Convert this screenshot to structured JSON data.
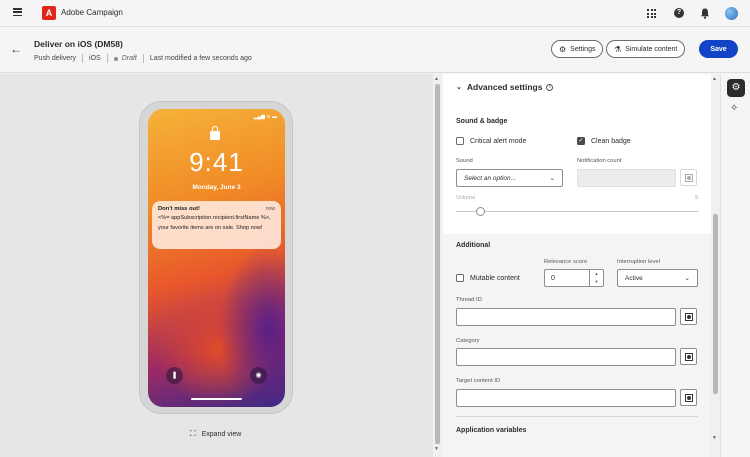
{
  "app": {
    "title": "Adobe Campaign",
    "logo_letter": "A"
  },
  "header": {
    "title": "Deliver on iOS (DM58)",
    "channel": "Push delivery",
    "platform": "iOS",
    "status": "Draft",
    "modified": "Last modified a few seconds ago",
    "settings_label": "Settings",
    "simulate_label": "Simulate content",
    "save_label": "Save"
  },
  "preview": {
    "status_icons": "▂▄▆ ≋ ▬",
    "time": "9:41",
    "date": "Monday, June 3",
    "notification": {
      "title": "Don't miss out!",
      "time": "now",
      "body": "<%= appSubscription.recipient.firstName %>, your favorite items are on sale. Shop now!"
    },
    "expand_label": "Expand view"
  },
  "panel": {
    "section_title": "Advanced settings",
    "sound_badge": {
      "heading": "Sound & badge",
      "critical_alert": {
        "label": "Critical alert mode",
        "checked": false
      },
      "clean_badge": {
        "label": "Clean badge",
        "checked": true
      },
      "sound_label": "Sound",
      "sound_placeholder": "Select an option...",
      "notification_count_label": "Notification count",
      "volume_label": "Volume",
      "volume_max": "9",
      "volume_value": 1
    },
    "additional": {
      "heading": "Additional",
      "mutable_content": {
        "label": "Mutable content",
        "checked": false
      },
      "relevance_label": "Relevance score",
      "relevance_value": "0",
      "interruption_label": "Interruption level",
      "interruption_value": "Active",
      "thread_id_label": "Thread ID",
      "category_label": "Category",
      "target_content_label": "Target content ID"
    },
    "app_variables_heading": "Application variables"
  },
  "colors": {
    "primary": "#1344c8",
    "adobe_red": "#e1251b"
  },
  "icons": {
    "menu": "hamburger-icon",
    "apps": "app-grid-icon",
    "help": "help-icon",
    "notifications": "bell-icon",
    "back": "arrow-left-icon",
    "settings": "settings-icon",
    "simulate": "simulate-icon",
    "expand": "expand-icon",
    "lock": "lock-icon",
    "flashlight": "flashlight-icon",
    "camera": "camera-icon",
    "properties": "gear-icon",
    "magic": "wand-icon"
  }
}
